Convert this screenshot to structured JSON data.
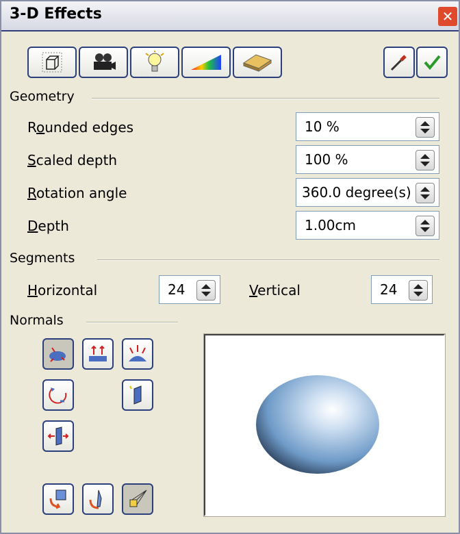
{
  "window": {
    "title": "3-D Effects"
  },
  "toolbar": {
    "geometry_icon": "cube-outline-icon",
    "shading_icon": "camera-icon",
    "illumination_icon": "light-bulb-icon",
    "textures_icon": "gradient-icon",
    "material_icon": "material-icon",
    "assign_icon": "eyedropper-icon",
    "apply_icon": "checkmark-icon"
  },
  "geometry": {
    "heading": "Geometry",
    "rounded_edges": {
      "label_pre": "R",
      "label_ul": "o",
      "label_post": "unded edges",
      "value": "10 %"
    },
    "scaled_depth": {
      "label_pre": "",
      "label_ul": "S",
      "label_post": "caled depth",
      "value": "100 %"
    },
    "rotation_angle": {
      "label_pre": "",
      "label_ul": "R",
      "label_post": "otation angle",
      "value": "360.0 degree(s)"
    },
    "depth": {
      "label_pre": "",
      "label_ul": "D",
      "label_post": "epth",
      "value": "1.00cm"
    }
  },
  "segments": {
    "heading": "Segments",
    "horizontal": {
      "label_ul": "H",
      "label_post": "orizontal",
      "value": "24"
    },
    "vertical": {
      "label_ul": "V",
      "label_post": "ertical",
      "value": "24"
    }
  },
  "normals": {
    "heading": "Normals"
  },
  "colors": {
    "accent": "#2b3f7c",
    "background": "#ece9d8"
  }
}
